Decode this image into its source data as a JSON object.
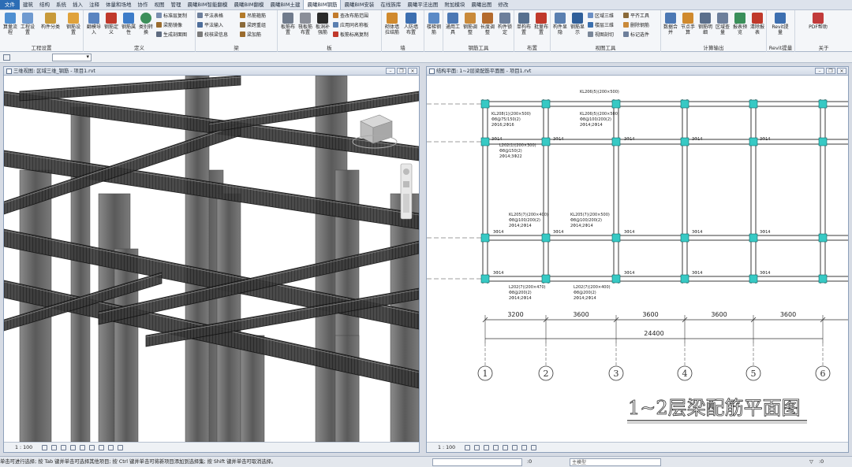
{
  "tabs": [
    {
      "label": "文件"
    },
    {
      "label": "建筑"
    },
    {
      "label": "结构"
    },
    {
      "label": "系统"
    },
    {
      "label": "插入"
    },
    {
      "label": "注释"
    },
    {
      "label": "体量和场地"
    },
    {
      "label": "协作"
    },
    {
      "label": "视图"
    },
    {
      "label": "管理"
    },
    {
      "label": "晨曦BIM智能翻模"
    },
    {
      "label": "晨曦BIM翻模"
    },
    {
      "label": "晨曦BIM土建"
    },
    {
      "label": "晨曦BIM钢筋"
    },
    {
      "label": "晨曦BIM安装"
    },
    {
      "label": "在线族库"
    },
    {
      "label": "晨曦平法出图"
    },
    {
      "label": "附加模块"
    },
    {
      "label": "晨曦出图"
    },
    {
      "label": "修改"
    }
  ],
  "ribbon": {
    "groups": {
      "engineering": "工程设置",
      "definition": "定义",
      "beam": "梁",
      "slab": "板",
      "wall": "墙",
      "rebar_tools": "钢筋工具",
      "layout": "布置",
      "view_tools": "视图工具",
      "calc_output": "计算输出",
      "revit_extract": "Revit提量",
      "about": "关于"
    },
    "buttons": {
      "calc_flow": "算量流程",
      "proj_setting": "工程设置",
      "member_class": "构件分类",
      "rebar_setting": "钢筋设置",
      "rebar_import": "翻模导入",
      "rebar_define": "钢筋定义",
      "rebar_attr": "钢筋属性",
      "class_convert": "类别转换",
      "std_copy": "标准层复制",
      "rebar_mirror": "梁筋镜像",
      "gen_section": "生成剖面图",
      "flat_table": "平法表格",
      "flat_input": "平法输入",
      "check_beam": "校核梁信息",
      "rebar_hoist": "吊筋箍筋",
      "beam_span_recog": "梁跨重组",
      "beam_top": "梁加筋",
      "slab_place": "板筋布置",
      "bottom_place": "筏板筋布置",
      "slab_rebar": "板洞补强筋",
      "same_name": "查改布筋范围",
      "apply_same": "应用同名称板",
      "slab_copy": "板筋标高复制",
      "block_wall": "砌体墙拉结筋",
      "human_defense": "人防墙布置",
      "stair_rebar": "楼梯钢筋",
      "general_tool": "通用工具",
      "rebar_adjust": "钢筋调整",
      "length_adjust": "长度调整",
      "member_lock": "构件锁定",
      "single_place": "单构布置",
      "batch_place": "批量布置",
      "member_show": "构件显隐",
      "rebar_show": "钢筋显示",
      "area_3d": "区域三维",
      "floor_3d": "楼层三维",
      "view_section": "视图剖切",
      "flat_tool": "平齐工具",
      "del_rebar": "删除钢筋",
      "mark_member": "标记选件",
      "data_merge": "数据合并",
      "node_manual": "节点手算",
      "rebar_detail": "钢筋明细",
      "area_count": "区域查量",
      "report_preview": "报表预览",
      "clear_report": "清除报表",
      "revit_extract": "Revit提量",
      "pdf_help": "PDF帮助"
    }
  },
  "views": {
    "left_title": "三维视图: 区域三维_钢筋 - 项目1.rvt",
    "right_title": "结构平面: 1~2层梁配筋平面图 - 项目1.rvt",
    "left_scale": "1 : 100",
    "right_scale": "1 : 100"
  },
  "plan": {
    "title": "1~2层梁配筋平面图",
    "dimensions": [
      "3200",
      "3600",
      "3600",
      "3600",
      "3600"
    ],
    "total": "24400",
    "axes": [
      "1",
      "2",
      "3",
      "4",
      "5",
      "6"
    ],
    "beam_labels": [
      "KL206(5)(200×500)",
      "KL208(1)(200×500)",
      "Φ8@75/150(2)",
      "2Φ16;2Φ16",
      "KL206(5)(200×500)",
      "Φ8@100/200(2)",
      "2Φ14;2Φ14",
      "L202(1)(200×300)",
      "Φ8@150(2)",
      "2Φ14;3Φ22",
      "KL205(7)(200×400)",
      "Φ8@100/200(2)",
      "2Φ14;2Φ14",
      "KL205(7)(200×500)",
      "Φ8@100/200(2)",
      "2Φ14;2Φ14",
      "L202(7)(200×470)",
      "Φ8@200(2)",
      "2Φ14;2Φ14",
      "L202(7)(200×400)",
      "Φ8@200(2)",
      "2Φ14;2Φ14"
    ],
    "rebar_marks": [
      "3Φ14",
      "3Φ14",
      "3Φ14",
      "3Φ14",
      "3Φ14",
      "3Φ14",
      "3Φ14",
      "3Φ14",
      "3Φ14",
      "3Φ14",
      "3Φ14",
      "3Φ14",
      "3Φ14",
      "3Φ14"
    ]
  },
  "status": {
    "text": "单击可进行选择; 按 Tab 键并单击可选择其他项目; 按 Ctrl 键并单击可将新项目添加到选择集; 按 Shift 键并单击可取消选择。",
    "model_label": "主模型",
    "zero_a": ":0",
    "zero_b": ":0"
  },
  "colors": {
    "accent": "#2c6db5",
    "plan_line": "#3a3a3a",
    "column_fill": "#37c9c4",
    "concrete": "#6b6b6b"
  }
}
